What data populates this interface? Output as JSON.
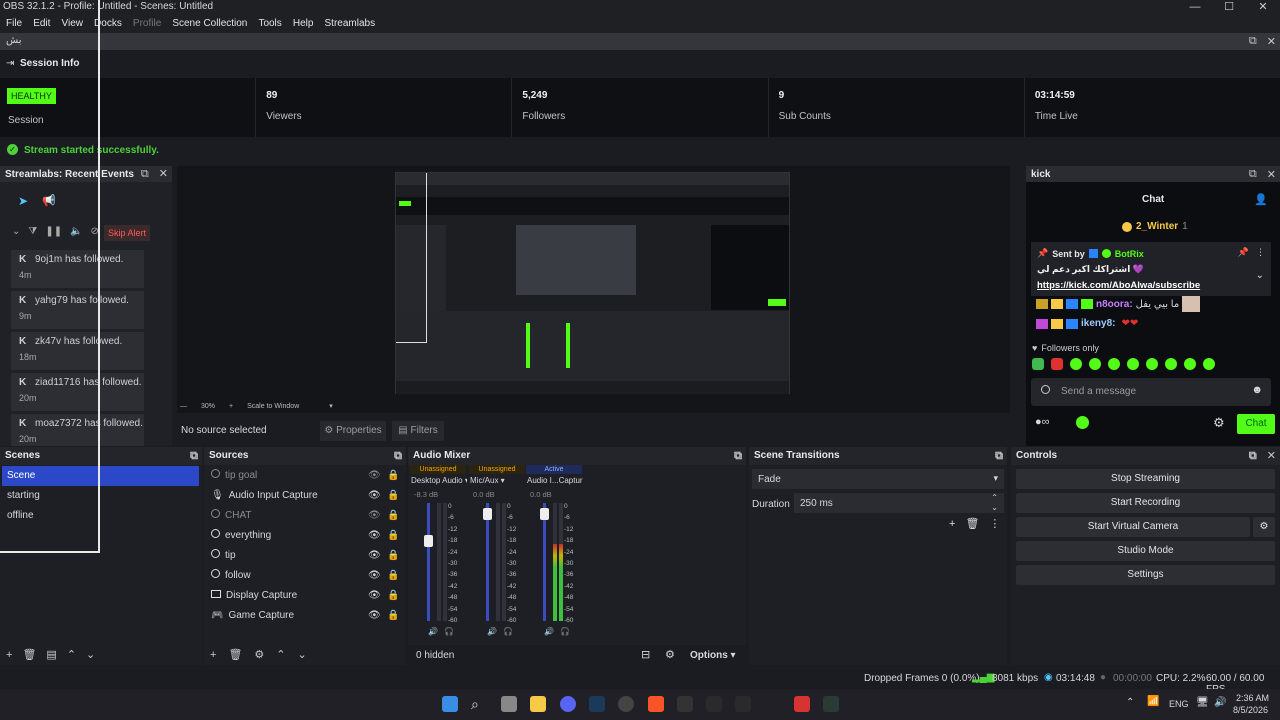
{
  "window": {
    "title": "OBS 32.1.2 - Profile: Untitled - Scenes: Untitled",
    "controls": [
      "—",
      "☐",
      "✕"
    ]
  },
  "menu": [
    "File",
    "Edit",
    "View",
    "Docks",
    "Profile",
    "Scene Collection",
    "Tools",
    "Help",
    "Streamlabs"
  ],
  "dock_bar": {
    "label": "بش"
  },
  "session": {
    "title": "Session Info",
    "health": "HEALTHY",
    "health_label": "Session",
    "stats": [
      {
        "value": "89",
        "label": "Viewers"
      },
      {
        "value": "5,249",
        "label": "Followers"
      },
      {
        "value": "9",
        "label": "Sub Counts"
      },
      {
        "value": "03:14:59",
        "label": "Time Live"
      }
    ],
    "toast": "Stream started successfully.",
    "colors": {
      "health": "#53fc18",
      "toast": "#4cd137"
    }
  },
  "recent": {
    "title": "Streamlabs: Recent Events",
    "skip": "Skip Alert",
    "events": [
      {
        "name": "9oj1m",
        "text": "has followed.",
        "time": "4m"
      },
      {
        "name": "yahg79",
        "text": "has followed.",
        "time": "9m"
      },
      {
        "name": "zk47v",
        "text": "has followed.",
        "time": "18m"
      },
      {
        "name": "ziad11716",
        "text": "has followed.",
        "time": "20m"
      },
      {
        "name": "moaz7372",
        "text": "has followed.",
        "time": "20m"
      }
    ]
  },
  "preview": {
    "zoom": "30%",
    "scale": "Scale to Window",
    "no_source": "No source selected",
    "properties": "Properties",
    "filters": "Filters"
  },
  "kick": {
    "dock_title": "kick",
    "chat_title": "Chat",
    "top_user": "2_Winter",
    "top_count": "1",
    "pinned_by": "Sent by",
    "pinned_user": "BotRix",
    "pinned_text": "اشتراكك اكبر دعم لي 💜",
    "pinned_link": "https://kick.com/AboAlwa/subscribe",
    "messages": [
      {
        "user": "n8oora:",
        "text": "ما بيي يفل"
      },
      {
        "user": "ikeny8:",
        "text": ""
      }
    ],
    "followers_only": "Followers only",
    "placeholder": "Send a message",
    "chat_button": "Chat",
    "accent": "#53fc18"
  },
  "scenes": {
    "title": "Scenes",
    "items": [
      "Scene",
      "starting",
      "offline"
    ],
    "selected": "Scene"
  },
  "sources": {
    "title": "Sources",
    "items": [
      {
        "name": "tip goal",
        "icon": "browser-icon",
        "visible": false
      },
      {
        "name": "Audio Input Capture",
        "icon": "mic-icon",
        "visible": true
      },
      {
        "name": "CHAT",
        "icon": "browser-icon",
        "visible": false
      },
      {
        "name": "everything",
        "icon": "browser-icon",
        "visible": true
      },
      {
        "name": "tip",
        "icon": "browser-icon",
        "visible": true
      },
      {
        "name": "follow",
        "icon": "browser-icon",
        "visible": true
      },
      {
        "name": "Display Capture",
        "icon": "monitor-icon",
        "visible": true
      },
      {
        "name": "Game Capture",
        "icon": "gamepad-icon",
        "visible": true
      }
    ]
  },
  "mixer": {
    "title": "Audio Mixer",
    "hidden": "0 hidden",
    "options": "Options",
    "channels": [
      {
        "status": "Unassigned",
        "name": "Desktop Audio",
        "db": "-8.3 dB",
        "level": 0,
        "fader": 0.7
      },
      {
        "status": "Unassigned",
        "name": "Mic/Aux",
        "db": "0.0 dB",
        "level": 0,
        "fader": 0.95
      },
      {
        "status": "Active",
        "name": "Audio I...Capture",
        "db": "0.0 dB",
        "level": 0.65,
        "fader": 0.95
      }
    ],
    "scale": [
      "0",
      "-6",
      "-12",
      "-18",
      "-24",
      "-30",
      "-36",
      "-42",
      "-48",
      "-54",
      "-60"
    ]
  },
  "transitions": {
    "title": "Scene Transitions",
    "type": "Fade",
    "duration_label": "Duration",
    "duration": "250 ms"
  },
  "controls": {
    "title": "Controls",
    "buttons": [
      "Stop Streaming",
      "Start Recording",
      "Start Virtual Camera",
      "Studio Mode",
      "Settings"
    ]
  },
  "status": {
    "dropped": "Dropped Frames 0 (0.0%)",
    "kbps": "8081 kbps",
    "stream_time": "03:14:48",
    "rec_time": "00:00:00",
    "cpu": "CPU: 2.2%",
    "fps": "60.00 / 60.00 FPS"
  },
  "taskbar": {
    "lang": "ENG",
    "time": "2:36 AM",
    "date": "8/5/2026"
  }
}
